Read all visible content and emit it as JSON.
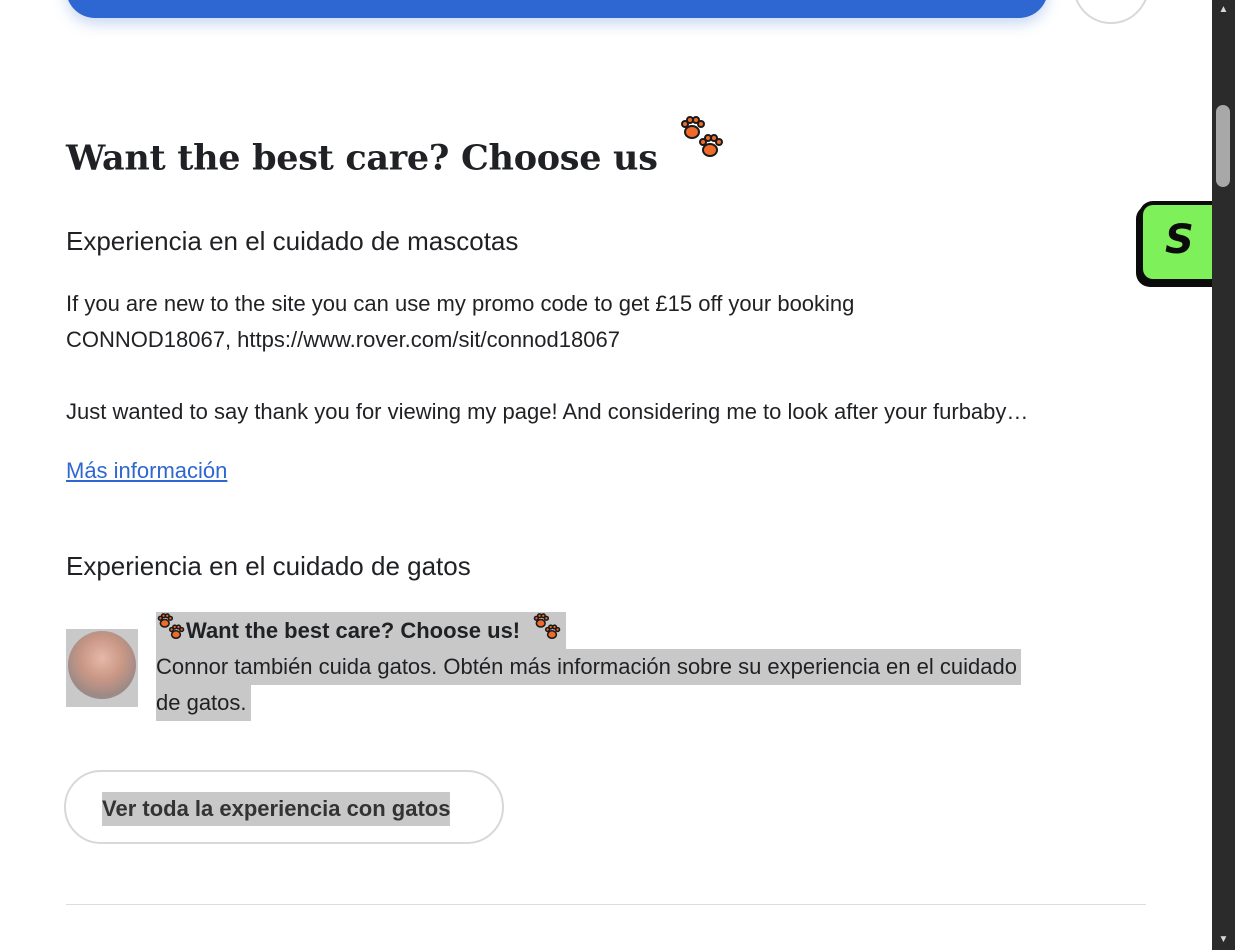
{
  "main": {
    "title": "Want the best care? Choose us",
    "pet_care": {
      "heading": "Experiencia en el cuidado de mascotas",
      "line1": "If you are new to the site you can use my promo code to get £15 off your booking",
      "line2": "CONNOD18067, https://www.rover.com/sit/connod18067",
      "line3": "Just wanted to say thank you for viewing my page! And considering me to look after your furbaby…",
      "more_link": "Más información"
    },
    "cat_care": {
      "heading": "Experiencia en el cuidado de gatos",
      "message_title": "Want the best care? Choose us!",
      "message_line1": "Connor también cuida gatos. Obtén más información sobre su experiencia en el cuidado",
      "message_line2": "de gatos.",
      "view_all_button": "Ver toda la experiencia con gatos"
    }
  },
  "floating_badge": {
    "letter": "S"
  },
  "colors": {
    "accent": "#2e67d1",
    "badge": "#7ef05a",
    "paw": "#f06a2a",
    "highlight": "#c8c8c8"
  },
  "icons": [
    "paw-prints-icon",
    "avatar",
    "scroll-up-icon",
    "scroll-down-icon"
  ]
}
